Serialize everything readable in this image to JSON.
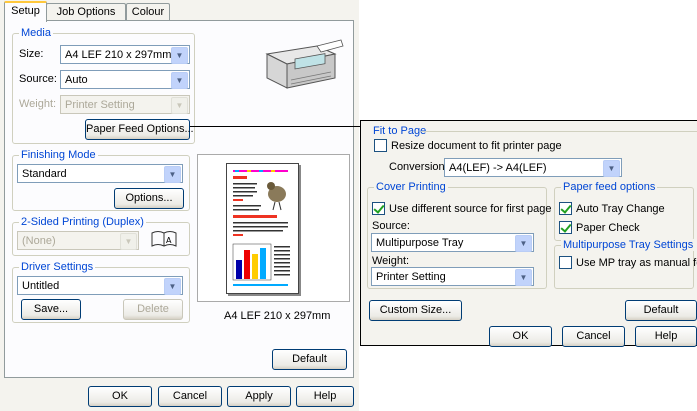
{
  "tabs": [
    "Setup",
    "Job Options",
    "Colour"
  ],
  "media": {
    "title": "Media",
    "size_label": "Size:",
    "size_value": "A4 LEF 210 x 297mm",
    "source_label": "Source:",
    "source_value": "Auto",
    "weight_label": "Weight:",
    "weight_value": "Printer Setting",
    "paper_feed_button": "Paper Feed Options..."
  },
  "finishing": {
    "title": "Finishing Mode",
    "value": "Standard",
    "options_button": "Options..."
  },
  "duplex": {
    "title": "2-Sided Printing (Duplex)",
    "value": "(None)"
  },
  "driver": {
    "title": "Driver Settings",
    "value": "Untitled",
    "save_button": "Save...",
    "delete_button": "Delete"
  },
  "preview": {
    "caption": "A4 LEF 210 x 297mm"
  },
  "default_button": "Default",
  "footer": {
    "ok": "OK",
    "cancel": "Cancel",
    "apply": "Apply",
    "help": "Help"
  },
  "popup": {
    "fit": {
      "title": "Fit to Page",
      "resize_label": "Resize document to fit printer page",
      "resize_checked": false,
      "conversion_label": "Conversion:",
      "conversion_value": "A4(LEF) -> A4(LEF)"
    },
    "cover": {
      "title": "Cover Printing",
      "use_diff_label": "Use different source for first page",
      "use_diff_checked": true,
      "source_label": "Source:",
      "source_value": "Multipurpose Tray",
      "weight_label": "Weight:",
      "weight_value": "Printer Setting"
    },
    "feed": {
      "title": "Paper feed options",
      "auto_tray_label": "Auto Tray Change",
      "auto_tray_checked": true,
      "paper_check_label": "Paper Check",
      "paper_check_checked": true
    },
    "mp": {
      "title": "Multipurpose Tray Settings",
      "manual_label": "Use MP tray as manual feed",
      "manual_checked": false
    },
    "custom_size_button": "Custom Size...",
    "default_button": "Default",
    "ok": "OK",
    "cancel": "Cancel",
    "help": "Help"
  }
}
